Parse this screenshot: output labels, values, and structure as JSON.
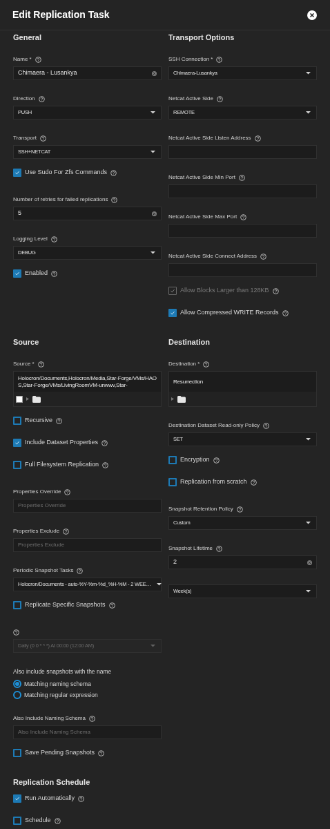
{
  "dialog": {
    "title": "Edit Replication Task"
  },
  "sections": [
    {
      "left": {
        "heading": "General",
        "items": [
          {
            "kind": "input",
            "label": "Name *",
            "help": true,
            "value": "Chimaera - Lusankya",
            "clearable": true
          },
          {
            "kind": "select",
            "label": "Direction",
            "help": true,
            "value": "PUSH",
            "disabled": false
          },
          {
            "kind": "select",
            "label": "Transport",
            "help": true,
            "value": "SSH+NETCAT",
            "disabled": false
          },
          {
            "kind": "checkbox",
            "label": "Use Sudo For Zfs Commands",
            "help": true,
            "checked": true,
            "disabled": false
          },
          {
            "kind": "input",
            "label": "Number of retries for failed replications",
            "help": true,
            "value": "5",
            "clearable": true
          },
          {
            "kind": "select",
            "label": "Logging Level",
            "help": true,
            "value": "DEBUG",
            "disabled": false
          },
          {
            "kind": "checkbox",
            "label": "Enabled",
            "help": true,
            "checked": true,
            "disabled": false
          }
        ]
      },
      "right": {
        "heading": "Transport Options",
        "items": [
          {
            "kind": "select",
            "label": "SSH Connection *",
            "help": true,
            "value": "Chimaera-Lusankya",
            "disabled": false
          },
          {
            "kind": "select",
            "label": "Netcat Active Side",
            "help": true,
            "value": "REMOTE",
            "disabled": false
          },
          {
            "kind": "input",
            "label": "Netcat Active Side Listen Address",
            "help": true,
            "clearable": false
          },
          {
            "kind": "input",
            "label": "Netcat Active Side Min Port",
            "help": true,
            "clearable": false
          },
          {
            "kind": "input",
            "label": "Netcat Active Side Max Port",
            "help": true,
            "clearable": false
          },
          {
            "kind": "input",
            "label": "Netcat Active Side Connect Address",
            "help": true,
            "clearable": false
          },
          {
            "kind": "checkbox",
            "label": "Allow Blocks Larger than 128KB",
            "help": true,
            "checked": true,
            "disabled": true
          },
          {
            "kind": "checkbox",
            "label": "Allow Compressed WRITE Records",
            "help": true,
            "checked": true,
            "disabled": false
          }
        ]
      }
    },
    {
      "left": {
        "heading": "Source",
        "items": [
          {
            "kind": "tree",
            "label": "Source *",
            "help": true,
            "value": "Holocron/Documents,Holocron/Media,Star-Forge/VMs/HAOS,Star-Forge/VMs/LivingRoomVM-unwwv,Star-",
            "node_checked": false
          },
          {
            "kind": "checkbox",
            "label": "Recursive",
            "help": true,
            "checked": false,
            "disabled": false
          },
          {
            "kind": "checkbox",
            "label": "Include Dataset Properties",
            "help": true,
            "checked": true,
            "disabled": false
          },
          {
            "kind": "checkbox",
            "label": "Full Filesystem Replication",
            "help": true,
            "checked": false,
            "disabled": false
          },
          {
            "kind": "input",
            "label": "Properties Override",
            "help": true,
            "placeholder": "Properties Override",
            "clearable": false
          },
          {
            "kind": "input",
            "label": "Properties Exclude",
            "help": true,
            "placeholder": "Properties Exclude",
            "clearable": false
          },
          {
            "kind": "select",
            "label": "Periodic Snapshot Tasks",
            "help": true,
            "value": "Holocron/Documents - auto-%Y-%m-%d_%H-%M - 2 WEE…",
            "disabled": false
          },
          {
            "kind": "checkbox",
            "label": "Replicate Specific Snapshots",
            "help": true,
            "checked": false,
            "disabled": false
          },
          {
            "kind": "select",
            "help": true,
            "value": "Daily (0 0 * * *)  At 00:00 (12:00 AM)",
            "disabled": true
          },
          {
            "kind": "radio_group",
            "label": "Also include snapshots with the name",
            "options": [
              {
                "label": "Matching naming schema",
                "selected": true
              },
              {
                "label": "Matching regular expression",
                "selected": false
              }
            ]
          },
          {
            "kind": "input",
            "label": "Also Include Naming Schema",
            "help": true,
            "placeholder": "Also Include Naming Schema",
            "clearable": false
          },
          {
            "kind": "checkbox",
            "label": "Save Pending Snapshots",
            "help": true,
            "checked": false,
            "disabled": false
          }
        ]
      },
      "right": {
        "heading": "Destination",
        "items": [
          {
            "kind": "tree",
            "label": "Destination *",
            "help": true,
            "value": "Resurrection"
          },
          {
            "kind": "select",
            "label": "Destination Dataset Read-only Policy",
            "help": true,
            "value": "SET",
            "disabled": false
          },
          {
            "kind": "checkbox",
            "label": "Encryption",
            "help": true,
            "checked": false,
            "disabled": false
          },
          {
            "kind": "checkbox",
            "label": "Replication from scratch",
            "help": true,
            "checked": false,
            "disabled": false
          },
          {
            "kind": "select",
            "label": "Snapshot Retention Policy",
            "help": true,
            "value": "Custom",
            "disabled": false
          },
          {
            "kind": "input",
            "label": "Snapshot Lifetime",
            "help": true,
            "value": "2",
            "clearable": true
          },
          {
            "kind": "select",
            "value": "Week(s)",
            "disabled": false
          }
        ]
      }
    },
    {
      "left": {
        "heading": "Replication Schedule",
        "items": [
          {
            "kind": "checkbox",
            "label": "Run Automatically",
            "help": true,
            "checked": true,
            "disabled": false
          },
          {
            "kind": "checkbox",
            "label": "Schedule",
            "help": true,
            "checked": false,
            "disabled": false
          }
        ]
      }
    }
  ]
}
